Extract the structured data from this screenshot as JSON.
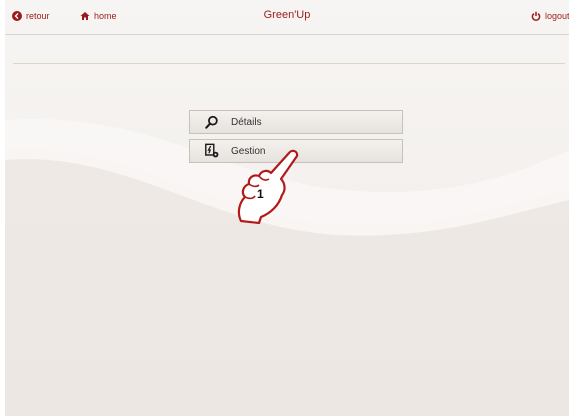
{
  "header": {
    "back_label": "retour",
    "home_label": "home",
    "title": "Green'Up",
    "logout_label": "logout"
  },
  "menu": {
    "items": [
      {
        "label": "Détails",
        "icon": "magnifier-icon"
      },
      {
        "label": "Gestion",
        "icon": "management-icon"
      }
    ]
  },
  "annotation": {
    "step_number": "1"
  },
  "colors": {
    "accent": "#9b1b1b",
    "panel_background": "#f3f0ed",
    "button_border": "#c9c1b9"
  }
}
